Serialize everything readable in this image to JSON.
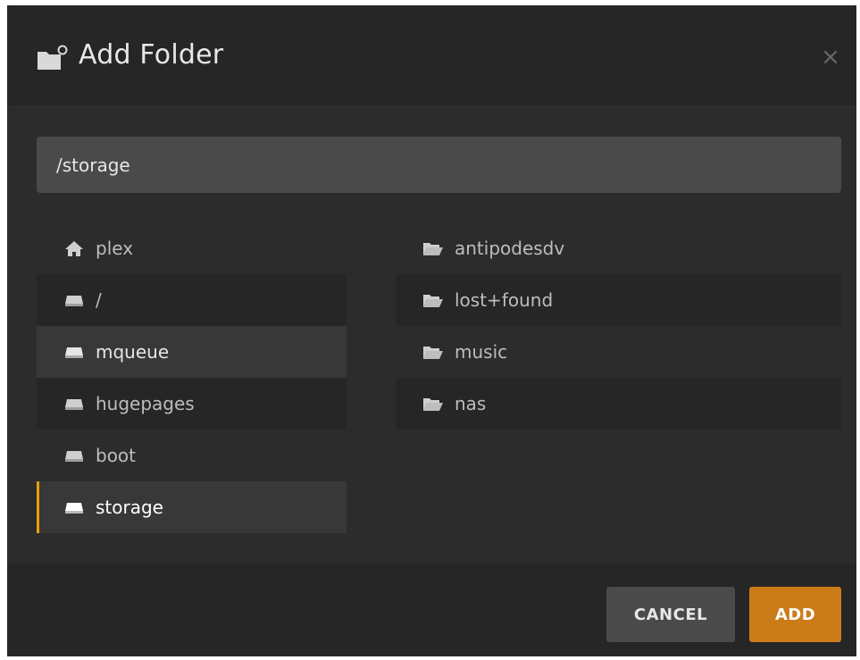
{
  "dialog": {
    "title": "Add Folder",
    "title_icon": "folder-add-icon",
    "close_icon": "close-icon",
    "close_glyph": "×"
  },
  "path_input": {
    "value": "/storage"
  },
  "locations": [
    {
      "label": "plex",
      "icon": "home-icon",
      "state": "normal"
    },
    {
      "label": "/",
      "icon": "drive-icon",
      "state": "alt"
    },
    {
      "label": "mqueue",
      "icon": "drive-icon",
      "state": "hover"
    },
    {
      "label": "hugepages",
      "icon": "drive-icon",
      "state": "alt"
    },
    {
      "label": "boot",
      "icon": "drive-icon",
      "state": "normal"
    },
    {
      "label": "storage",
      "icon": "drive-icon",
      "state": "selected"
    }
  ],
  "folders": [
    {
      "label": "antipodesdv",
      "icon": "folder-open-icon"
    },
    {
      "label": "lost+found",
      "icon": "folder-open-icon"
    },
    {
      "label": "music",
      "icon": "folder-open-icon"
    },
    {
      "label": "nas",
      "icon": "folder-open-icon"
    }
  ],
  "buttons": {
    "cancel_label": "CANCEL",
    "add_label": "ADD"
  },
  "colors": {
    "accent": "#cc7b19",
    "selection_marker": "#e5a00d",
    "background": "#2c2c2c"
  }
}
